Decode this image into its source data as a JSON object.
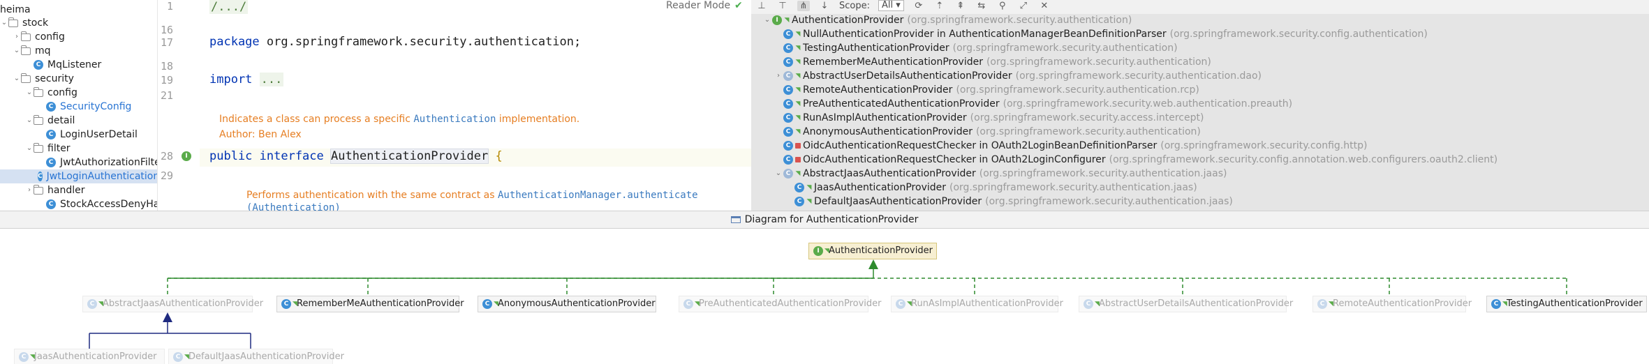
{
  "tree": {
    "items": [
      {
        "label": "heima",
        "indent": 0,
        "type": "root"
      },
      {
        "label": "stock",
        "indent": 0,
        "type": "folder-open"
      },
      {
        "label": "config",
        "indent": 1,
        "type": "folder"
      },
      {
        "label": "mq",
        "indent": 1,
        "type": "folder-open"
      },
      {
        "label": "MqListener",
        "indent": 2,
        "type": "class"
      },
      {
        "label": "security",
        "indent": 1,
        "type": "folder-open"
      },
      {
        "label": "config",
        "indent": 2,
        "type": "folder-open"
      },
      {
        "label": "SecurityConfig",
        "indent": 3,
        "type": "class-blue"
      },
      {
        "label": "detail",
        "indent": 2,
        "type": "folder-open"
      },
      {
        "label": "LoginUserDetail",
        "indent": 3,
        "type": "class"
      },
      {
        "label": "filter",
        "indent": 2,
        "type": "folder-open"
      },
      {
        "label": "JwtAuthorizationFilter",
        "indent": 3,
        "type": "class"
      },
      {
        "label": "JwtLoginAuthenticationFilt",
        "indent": 3,
        "type": "class-selected"
      },
      {
        "label": "handler",
        "indent": 2,
        "type": "folder"
      },
      {
        "label": "StockAccessDenyHandler",
        "indent": 3,
        "type": "class"
      }
    ]
  },
  "editor": {
    "reader_mode": "Reader Mode",
    "lines": [
      {
        "num": "1",
        "text": "/.../"
      },
      {
        "num": "16",
        "text": ""
      },
      {
        "num": "17",
        "keyword": "package",
        "text": "org.springframework.security.authentication;"
      },
      {
        "num": "18",
        "text": ""
      },
      {
        "num": "19",
        "keyword": "import",
        "fold": "..."
      },
      {
        "num": "21",
        "text": ""
      },
      {
        "num": "28",
        "keyword": "public interface",
        "type_name": "AuthenticationProvider",
        "brace": "{"
      },
      {
        "num": "29",
        "text": ""
      }
    ],
    "doc1_pre": "Indicates a class can process a specific",
    "doc1_code": "Authentication",
    "doc1_post": "implementation.",
    "doc1_author": "Author: Ben Alex",
    "doc2_pre": "Performs authentication with the same contract as",
    "doc2_code": "AuthenticationManager.authenticate",
    "doc2_code2": "(Authentication)"
  },
  "hierarchy": {
    "scope_label": "Scope:",
    "scope_value": "All",
    "rows": [
      {
        "name": "AuthenticationProvider",
        "pkg": "(org.springframework.security.authentication)",
        "level": 0,
        "icon": "iface",
        "expanded": true
      },
      {
        "name": "NullAuthenticationProvider in AuthenticationManagerBeanDefinitionParser",
        "pkg": "(org.springframework.security.config.authentication)",
        "level": 1,
        "icon": "class"
      },
      {
        "name": "TestingAuthenticationProvider",
        "pkg": "(org.springframework.security.authentication)",
        "level": 1,
        "icon": "class"
      },
      {
        "name": "RememberMeAuthenticationProvider",
        "pkg": "(org.springframework.security.authentication)",
        "level": 1,
        "icon": "class"
      },
      {
        "name": "AbstractUserDetailsAuthenticationProvider",
        "pkg": "(org.springframework.security.authentication.dao)",
        "level": 1,
        "icon": "abs",
        "collapsed": true
      },
      {
        "name": "RemoteAuthenticationProvider",
        "pkg": "(org.springframework.security.authentication.rcp)",
        "level": 1,
        "icon": "class"
      },
      {
        "name": "PreAuthenticatedAuthenticationProvider",
        "pkg": "(org.springframework.security.web.authentication.preauth)",
        "level": 1,
        "icon": "class"
      },
      {
        "name": "RunAsImplAuthenticationProvider",
        "pkg": "(org.springframework.security.access.intercept)",
        "level": 1,
        "icon": "class"
      },
      {
        "name": "AnonymousAuthenticationProvider",
        "pkg": "(org.springframework.security.authentication)",
        "level": 1,
        "icon": "class"
      },
      {
        "name": "OidcAuthenticationRequestChecker in OAuth2LoginBeanDefinitionParser",
        "pkg": "(org.springframework.security.config.http)",
        "level": 1,
        "icon": "class",
        "lock": true
      },
      {
        "name": "OidcAuthenticationRequestChecker in OAuth2LoginConfigurer",
        "pkg": "(org.springframework.security.config.annotation.web.configurers.oauth2.client)",
        "level": 1,
        "icon": "class",
        "lock": true
      },
      {
        "name": "AbstractJaasAuthenticationProvider",
        "pkg": "(org.springframework.security.authentication.jaas)",
        "level": 1,
        "icon": "abs",
        "expanded": true
      },
      {
        "name": "JaasAuthenticationProvider",
        "pkg": "(org.springframework.security.authentication.jaas)",
        "level": 2,
        "icon": "class"
      },
      {
        "name": "DefaultJaasAuthenticationProvider",
        "pkg": "(org.springframework.security.authentication.jaas)",
        "level": 2,
        "icon": "class"
      }
    ]
  },
  "diagram": {
    "title": "Diagram for AuthenticationProvider",
    "root": "AuthenticationProvider",
    "children": [
      {
        "name": "AbstractJaasAuthenticationProvider",
        "dim": true
      },
      {
        "name": "RememberMeAuthenticationProvider",
        "dim": false
      },
      {
        "name": "AnonymousAuthenticationProvider",
        "dim": false
      },
      {
        "name": "PreAuthenticatedAuthenticationProvider",
        "dim": true
      },
      {
        "name": "RunAsImplAuthenticationProvider",
        "dim": true
      },
      {
        "name": "AbstractUserDetailsAuthenticationProvider",
        "dim": true
      },
      {
        "name": "RemoteAuthenticationProvider",
        "dim": true
      },
      {
        "name": "TestingAuthenticationProvider",
        "dim": false
      }
    ],
    "grandchildren": [
      {
        "name": "JaasAuthenticationProvider",
        "dim": true
      },
      {
        "name": "DefaultJaasAuthenticationProvider",
        "dim": true
      }
    ]
  }
}
